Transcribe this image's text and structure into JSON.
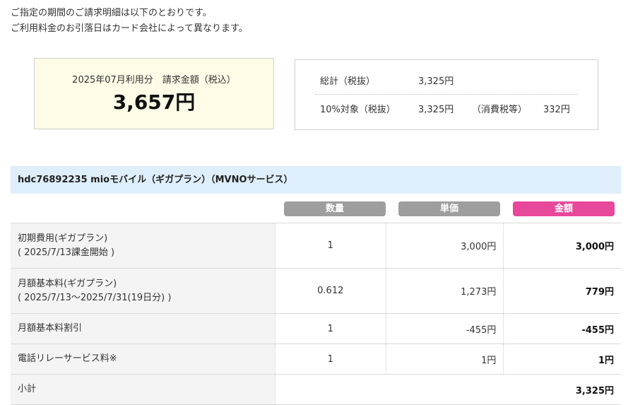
{
  "intro": {
    "line1": "ご指定の期間のご請求明細は以下のとおりです。",
    "line2": "ご利用料金のお引落日はカード会社によって異なります。"
  },
  "summary": {
    "caption": "2025年07月利用分　請求金額（税込）",
    "amount": "3,657円"
  },
  "tax": {
    "total_label": "総計（税抜）",
    "total_value": "3,325円",
    "rate_label": "10%対象（税抜）",
    "rate_value": "3,325円",
    "consumption_label": "（消費税等）",
    "consumption_value": "332円"
  },
  "plan": {
    "title": "hdc76892235 mioモバイル（ギガプラン）（MVNOサービス）"
  },
  "columns": {
    "qty": "数量",
    "unit": "単価",
    "amount": "金額"
  },
  "rows": [
    {
      "label": "初期費用(ギガプラン)",
      "sub": "( 2025/7/13課金開始 )",
      "qty": "1",
      "unit": "3,000円",
      "amount": "3,000円"
    },
    {
      "label": "月額基本料(ギガプラン)",
      "sub": "( 2025/7/13～2025/7/31(19日分) )",
      "qty": "0.612",
      "unit": "1,273円",
      "amount": "779円"
    },
    {
      "label": "月額基本料割引",
      "qty": "1",
      "unit": "-455円",
      "amount": "-455円"
    },
    {
      "label": "電話リレーサービス料※",
      "qty": "1",
      "unit": "1円",
      "amount": "1円"
    }
  ],
  "subtotal": {
    "label": "小計",
    "amount": "3,325円"
  },
  "colors": {
    "plan_header_bg": "#deeefa",
    "summary_bg": "#fefbe6",
    "amount_pill": "#e8489a",
    "gray_pill": "#9e9e9e"
  }
}
